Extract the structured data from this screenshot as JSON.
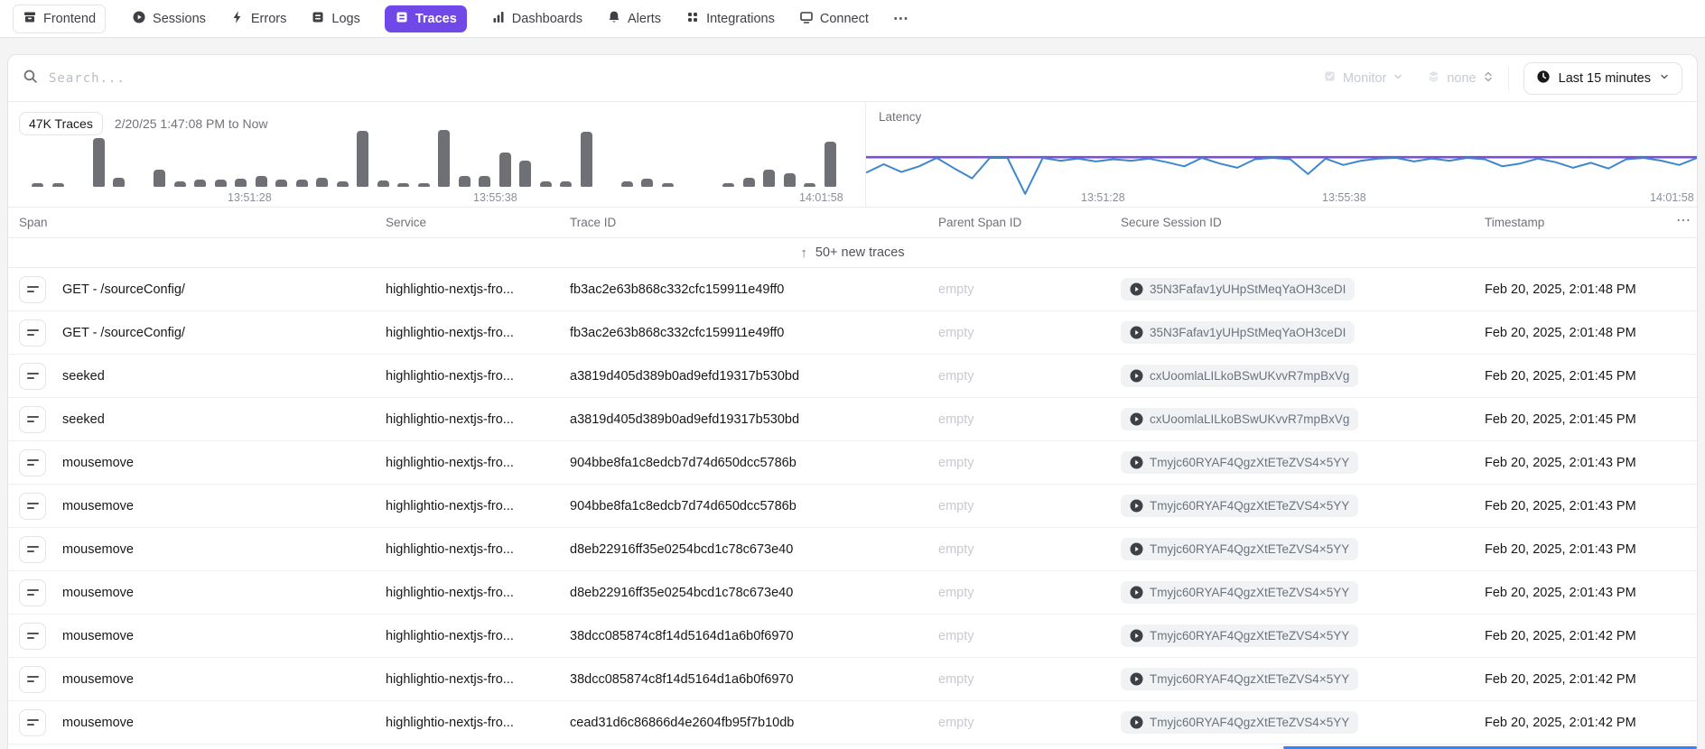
{
  "colors": {
    "accent_purple": "#7048e8",
    "latency_line_blue": "#3e87cf",
    "latency_line_purple": "#7a4fd6",
    "histogram_bar": "#6e7075",
    "new_row_indicator_blue": "#3b82f6"
  },
  "nav": {
    "items": [
      {
        "label": "Frontend"
      },
      {
        "label": "Sessions"
      },
      {
        "label": "Errors"
      },
      {
        "label": "Logs"
      },
      {
        "label": "Traces"
      },
      {
        "label": "Dashboards"
      },
      {
        "label": "Alerts"
      },
      {
        "label": "Integrations"
      },
      {
        "label": "Connect"
      }
    ],
    "more_label": "⋯"
  },
  "toolbar": {
    "search_placeholder": "Search...",
    "monitor_label": "Monitor",
    "view_label": "none",
    "time_range_label": "Last 15 minutes"
  },
  "summary": {
    "count_badge": "47K Traces",
    "range_text": "2/20/25 1:47:08 PM to Now"
  },
  "chart_data": [
    {
      "type": "bar",
      "name": "traces-count-histogram",
      "x_tick_labels": [
        "13:51:28",
        "13:55:38",
        "14:01:58"
      ],
      "units": "relative bar heights 0-1 (y axis unlabeled in UI)",
      "values_relative": [
        0.05,
        0.04,
        0,
        0.85,
        0.15,
        0,
        0.3,
        0.09,
        0.12,
        0.13,
        0.14,
        0.19,
        0.13,
        0.13,
        0.15,
        0.09,
        0.97,
        0.11,
        0.07,
        0.07,
        0.98,
        0.18,
        0.18,
        0.6,
        0.46,
        0.09,
        0.09,
        0.95,
        0,
        0.09,
        0.14,
        0.07,
        0,
        0,
        0.07,
        0.15,
        0.3,
        0.23,
        0.07,
        0.78
      ],
      "bar_color": "#6e7075"
    },
    {
      "type": "line",
      "name": "latency-chart",
      "title": "Latency",
      "x_tick_labels": [
        "13:51:28",
        "13:55:38",
        "14:01:58"
      ],
      "units": "normalized vertical position from chart top, 0-1 (y axis unlabeled in UI)",
      "series": [
        {
          "name": "upper-flat-line",
          "color": "#7a4fd6",
          "values_normalized": [
            0.4,
            0.4
          ]
        },
        {
          "name": "latency-line",
          "color": "#3e87cf",
          "values_normalized": [
            0.62,
            0.5,
            0.61,
            0.53,
            0.41,
            0.56,
            0.7,
            0.41,
            0.41,
            0.92,
            0.41,
            0.45,
            0.42,
            0.46,
            0.43,
            0.45,
            0.42,
            0.47,
            0.53,
            0.41,
            0.49,
            0.55,
            0.43,
            0.41,
            0.43,
            0.64,
            0.42,
            0.51,
            0.45,
            0.42,
            0.41,
            0.46,
            0.42,
            0.45,
            0.41,
            0.43,
            0.53,
            0.49,
            0.42,
            0.47,
            0.55,
            0.48,
            0.56,
            0.43,
            0.41,
            0.45,
            0.51,
            0.41
          ]
        }
      ],
      "legend": "none shown"
    }
  ],
  "table": {
    "columns": [
      "Span",
      "Service",
      "Trace ID",
      "Parent Span ID",
      "Secure Session ID",
      "Timestamp"
    ],
    "header_menu": "⋯",
    "banner": {
      "arrow": "↑",
      "label": "50+ new traces"
    },
    "rows": [
      {
        "span": "GET - /sourceConfig/",
        "service": "highlightio-nextjs-fro...",
        "trace_id": "fb3ac2e63b868c332cfc159911e49ff0",
        "parent_span_id": "empty",
        "session_id": "35N3Fafav1yUHpStMeqYaOH3ceDI",
        "timestamp": "Feb 20, 2025, 2:01:48 PM"
      },
      {
        "span": "GET - /sourceConfig/",
        "service": "highlightio-nextjs-fro...",
        "trace_id": "fb3ac2e63b868c332cfc159911e49ff0",
        "parent_span_id": "empty",
        "session_id": "35N3Fafav1yUHpStMeqYaOH3ceDI",
        "timestamp": "Feb 20, 2025, 2:01:48 PM"
      },
      {
        "span": "seeked",
        "service": "highlightio-nextjs-fro...",
        "trace_id": "a3819d405d389b0ad9efd19317b530bd",
        "parent_span_id": "empty",
        "session_id": "cxUoomlaLILkoBSwUKvvR7mpBxVg",
        "timestamp": "Feb 20, 2025, 2:01:45 PM"
      },
      {
        "span": "seeked",
        "service": "highlightio-nextjs-fro...",
        "trace_id": "a3819d405d389b0ad9efd19317b530bd",
        "parent_span_id": "empty",
        "session_id": "cxUoomlaLILkoBSwUKvvR7mpBxVg",
        "timestamp": "Feb 20, 2025, 2:01:45 PM"
      },
      {
        "span": "mousemove",
        "service": "highlightio-nextjs-fro...",
        "trace_id": "904bbe8fa1c8edcb7d74d650dcc5786b",
        "parent_span_id": "empty",
        "session_id": "Tmyjc60RYAF4QgzXtETeZVS4×5YY",
        "timestamp": "Feb 20, 2025, 2:01:43 PM"
      },
      {
        "span": "mousemove",
        "service": "highlightio-nextjs-fro...",
        "trace_id": "904bbe8fa1c8edcb7d74d650dcc5786b",
        "parent_span_id": "empty",
        "session_id": "Tmyjc60RYAF4QgzXtETeZVS4×5YY",
        "timestamp": "Feb 20, 2025, 2:01:43 PM"
      },
      {
        "span": "mousemove",
        "service": "highlightio-nextjs-fro...",
        "trace_id": "d8eb22916ff35e0254bcd1c78c673e40",
        "parent_span_id": "empty",
        "session_id": "Tmyjc60RYAF4QgzXtETeZVS4×5YY",
        "timestamp": "Feb 20, 2025, 2:01:43 PM"
      },
      {
        "span": "mousemove",
        "service": "highlightio-nextjs-fro...",
        "trace_id": "d8eb22916ff35e0254bcd1c78c673e40",
        "parent_span_id": "empty",
        "session_id": "Tmyjc60RYAF4QgzXtETeZVS4×5YY",
        "timestamp": "Feb 20, 2025, 2:01:43 PM"
      },
      {
        "span": "mousemove",
        "service": "highlightio-nextjs-fro...",
        "trace_id": "38dcc085874c8f14d5164d1a6b0f6970",
        "parent_span_id": "empty",
        "session_id": "Tmyjc60RYAF4QgzXtETeZVS4×5YY",
        "timestamp": "Feb 20, 2025, 2:01:42 PM"
      },
      {
        "span": "mousemove",
        "service": "highlightio-nextjs-fro...",
        "trace_id": "38dcc085874c8f14d5164d1a6b0f6970",
        "parent_span_id": "empty",
        "session_id": "Tmyjc60RYAF4QgzXtETeZVS4×5YY",
        "timestamp": "Feb 20, 2025, 2:01:42 PM"
      },
      {
        "span": "mousemove",
        "service": "highlightio-nextjs-fro...",
        "trace_id": "cead31d6c86866d4e2604fb95f7b10db",
        "parent_span_id": "empty",
        "session_id": "Tmyjc60RYAF4QgzXtETeZVS4×5YY",
        "timestamp": "Feb 20, 2025, 2:01:42 PM"
      }
    ]
  }
}
